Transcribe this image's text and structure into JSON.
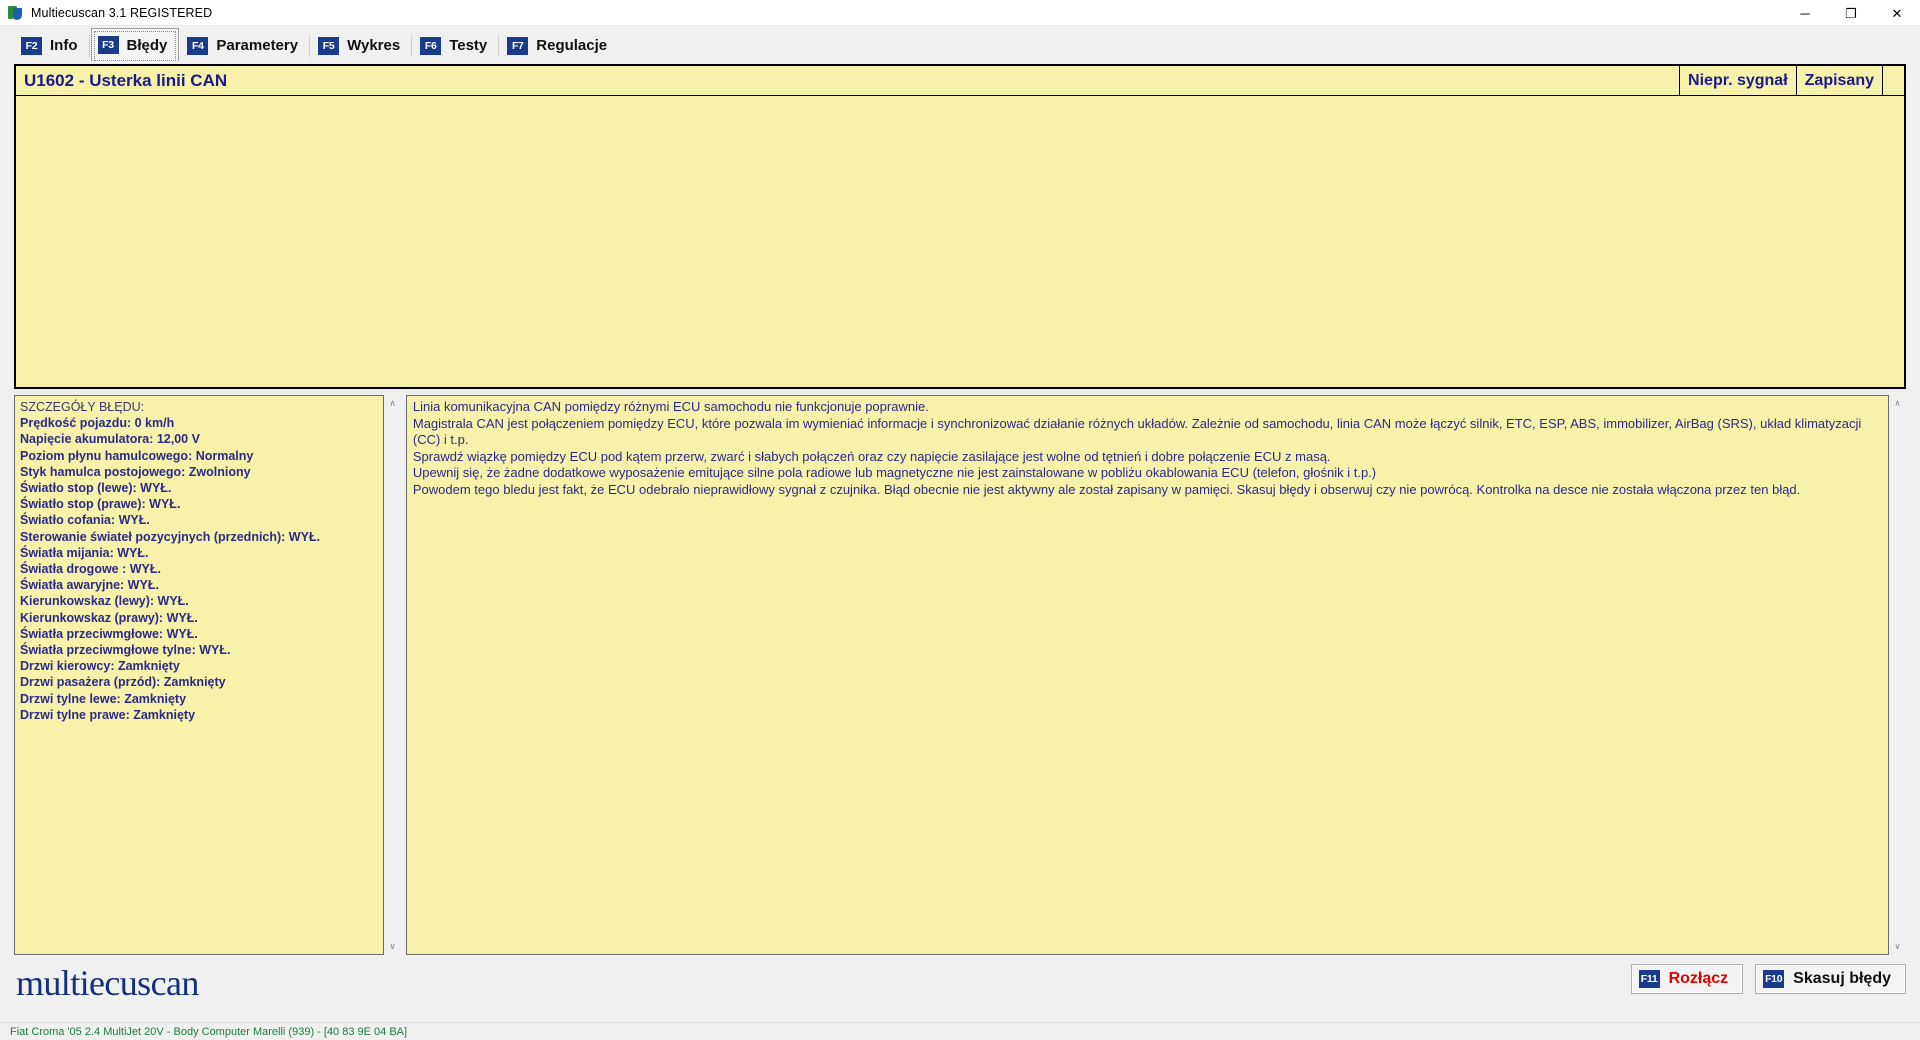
{
  "window": {
    "title": "Multiecuscan 3.1 REGISTERED",
    "icon": "shield-icon",
    "controls": {
      "minimize": "─",
      "maximize": "❐",
      "close": "✕"
    }
  },
  "tabs": [
    {
      "fkey": "F2",
      "label": "Info",
      "active": false
    },
    {
      "fkey": "F3",
      "label": "Błędy",
      "active": true
    },
    {
      "fkey": "F4",
      "label": "Parametery",
      "active": false
    },
    {
      "fkey": "F5",
      "label": "Wykres",
      "active": false
    },
    {
      "fkey": "F6",
      "label": "Testy",
      "active": false
    },
    {
      "fkey": "F7",
      "label": "Regulacje",
      "active": false
    }
  ],
  "error_list": {
    "code_and_name": "U1602 - Usterka linii CAN",
    "status_signal": "Niepr. sygnał",
    "status_stored": "Zapisany"
  },
  "details": {
    "heading": "SZCZEGÓŁY BŁĘDU:",
    "lines": [
      "Prędkość pojazdu: 0 km/h",
      "Napięcie akumulatora: 12,00 V",
      "Poziom płynu hamulcowego: Normalny",
      "Styk hamulca postojowego: Zwolniony",
      "Światło stop (lewe): WYŁ.",
      "Światło stop (prawe): WYŁ.",
      "Światło cofania: WYŁ.",
      "Sterowanie świateł pozycyjnych (przednich): WYŁ.",
      "Światła mijania: WYŁ.",
      "Światła drogowe : WYŁ.",
      "Światła awaryjne: WYŁ.",
      "Kierunkowskaz (lewy): WYŁ.",
      "Kierunkowskaz (prawy): WYŁ.",
      "Światła przeciwmgłowe: WYŁ.",
      "Światła przeciwmgłowe tylne: WYŁ.",
      "Drzwi kierowcy: Zamknięty",
      "Drzwi pasażera (przód): Zamknięty",
      "Drzwi tylne lewe: Zamknięty",
      "Drzwi tylne prawe: Zamknięty"
    ]
  },
  "description": {
    "paragraphs": [
      "Linia komunikacyjna CAN pomiędzy różnymi ECU samochodu nie funkcjonuje poprawnie.",
      " Magistrala CAN jest połączeniem pomiędzy ECU, które pozwala im wymieniać informacje i synchronizować działanie różnych układów. Zależnie od samochodu, linia CAN może łączyć silnik, ETC, ESP, ABS, immobilizer, AirBag (SRS), układ klimatyzacji (CC) i t.p.",
      " Sprawdź wiązkę pomiędzy ECU pod kątem przerw, zwarć i słabych połączeń oraz czy napięcie zasilające jest wolne od tętnień i dobre połączenie ECU z masą.",
      "Upewnij się, że żadne dodatkowe wyposażenie emitujące silne pola radiowe lub magnetyczne nie jest zainstalowane w pobliżu okablowania ECU (telefon, głośnik i t.p.)",
      "Powodem tego bledu jest fakt, że ECU odebrało nieprawidłowy sygnał z czujnika. Błąd obecnie nie jest aktywny ale został zapisany w pamięci. Skasuj błędy i obserwuj czy nie powrócą. Kontrolka na desce nie została włączona przez ten błąd."
    ]
  },
  "scrollbars": {
    "up_arrow": "∧",
    "down_arrow": "∨"
  },
  "footer": {
    "logo": "multiecuscan",
    "buttons": [
      {
        "fkey": "F11",
        "label": "Rozłącz",
        "color": "red"
      },
      {
        "fkey": "F10",
        "label": "Skasuj błędy",
        "color": "black"
      }
    ]
  },
  "statusbar": {
    "text": "Fiat Croma '05 2.4 MultiJet 20V - Body Computer Marelli (939) - [40 83 9E 04 BA]"
  },
  "colors": {
    "yellow_panel": "#f7f2a9",
    "navy_text": "#2a2a8c",
    "fkey_badge": "#1a3a8c",
    "status_green": "#1f7a3d",
    "logo_navy": "#14307a",
    "disconnect_red": "#e00000"
  }
}
